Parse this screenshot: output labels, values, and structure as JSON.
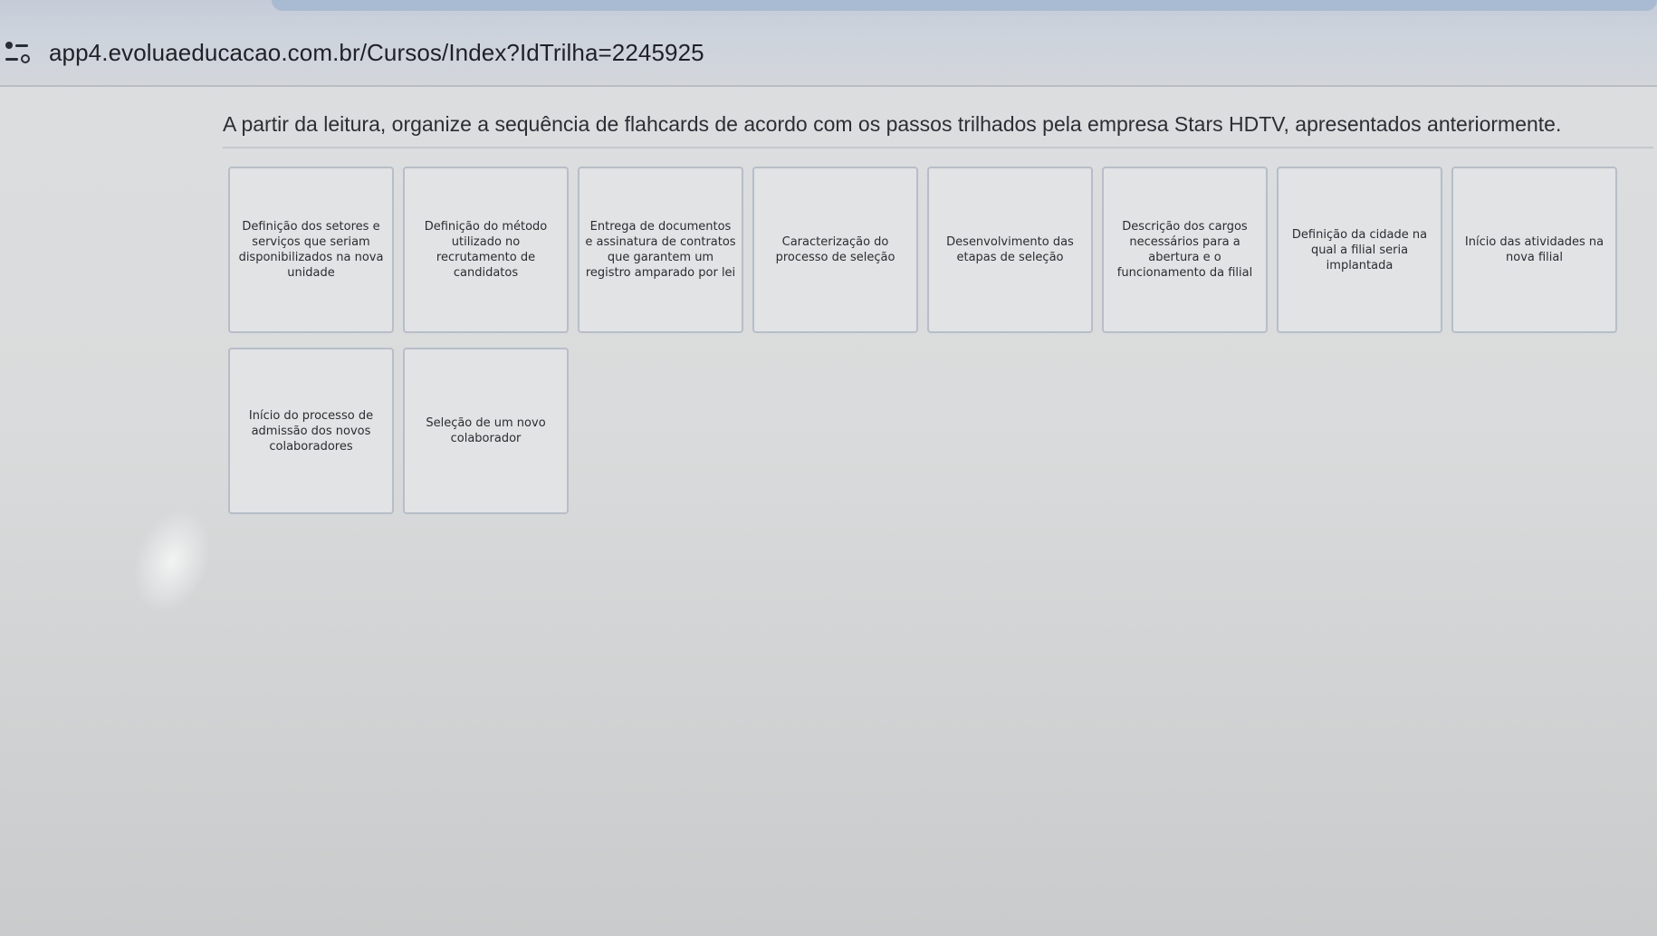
{
  "browser": {
    "url": "app4.evoluaeducacao.com.br/Cursos/Index?IdTrilha=2245925",
    "site_info_icon": "tune-icon"
  },
  "question": {
    "instruction": "A partir da leitura, organize a sequência de flahcards de acordo com os passos trilhados pela empresa Stars HDTV, apresentados anteriormente."
  },
  "flashcards": {
    "row1": [
      "Definição dos setores e serviços que seriam disponibilizados na nova unidade",
      "Definição do método utilizado no recrutamento de candidatos",
      "Entrega de documentos e assinatura de contratos que garantem um registro amparado por lei",
      "Caracterização do processo de seleção",
      "Desenvolvimento das etapas de seleção",
      "Descrição dos cargos necessários para a abertura e o funcionamento da filial",
      "Definição da cidade na qual a filial seria implantada",
      "Início das atividades na nova filial"
    ],
    "row2": [
      "Início do processo de admissão dos novos colaboradores",
      "Seleção de um novo colaborador"
    ]
  }
}
